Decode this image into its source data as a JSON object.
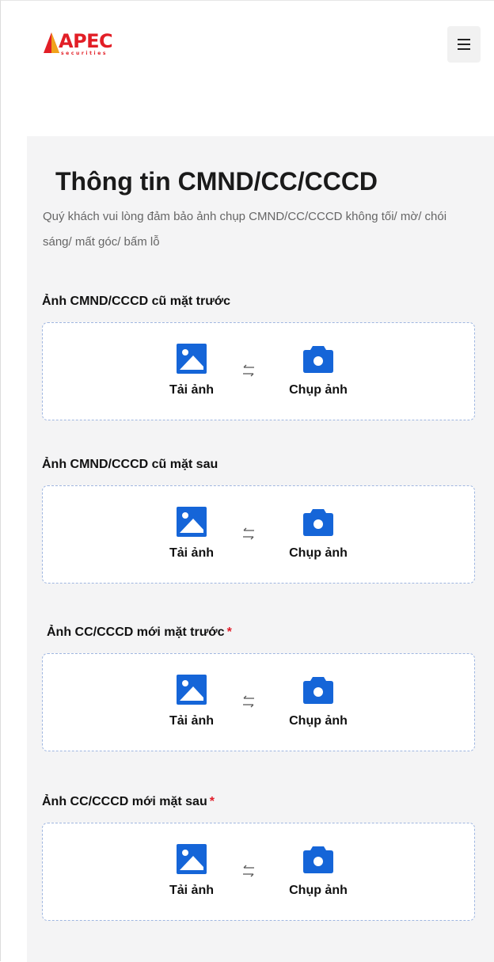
{
  "header": {
    "logo_text": "APEC",
    "logo_subtext": "securities",
    "menu_icon": "hamburger-menu-icon"
  },
  "main": {
    "title": "Thông tin CMND/CC/CCCD",
    "description": "Quý khách vui lòng đảm bảo ảnh chụp CMND/CC/CCCD không tối/ mờ/ chói sáng/ mất góc/ bấm lỗ",
    "sections": [
      {
        "label": "Ảnh CMND/CCCD cũ mặt trước",
        "required": false,
        "upload_label": "Tải ảnh",
        "camera_label": "Chụp ảnh"
      },
      {
        "label": "Ảnh CMND/CCCD cũ mặt sau",
        "required": false,
        "upload_label": "Tải ảnh",
        "camera_label": "Chụp ảnh"
      },
      {
        "label": "Ảnh CC/CCCD mới mặt trước",
        "required": true,
        "required_mark": "*",
        "upload_label": "Tải ảnh",
        "camera_label": "Chụp ảnh"
      },
      {
        "label": "Ảnh CC/CCCD mới mặt sau",
        "required": true,
        "required_mark": "*",
        "upload_label": "Tải ảnh",
        "camera_label": "Chụp ảnh"
      }
    ]
  },
  "icons": {
    "upload": "image-icon",
    "camera": "camera-icon",
    "swap": "swap-arrows-icon"
  },
  "colors": {
    "brand": "#e21e26",
    "accent": "#1565d8",
    "required": "#e11d2a",
    "panel_bg": "#f4f4f5",
    "box_border": "#9fb6e0"
  }
}
